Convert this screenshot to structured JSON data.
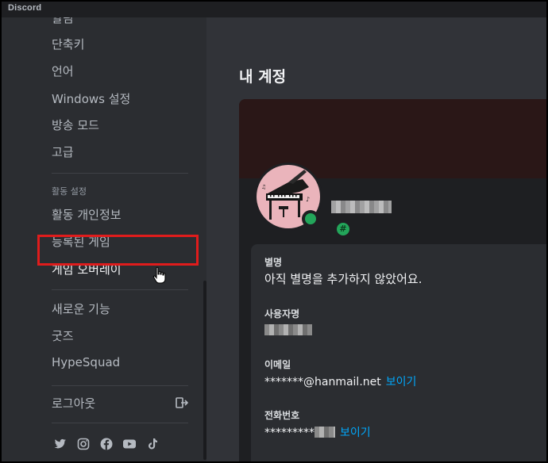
{
  "app": {
    "title": "Discord"
  },
  "sidebar": {
    "cut_item": "알림",
    "app_settings": [
      "단축키",
      "언어",
      "Windows 설정",
      "방송 모드",
      "고급"
    ],
    "activity_header": "활동 설정",
    "activity_items": [
      "활동 개인정보",
      "등록된 게임",
      "게임 오버레이"
    ],
    "misc_items": [
      "새로운 기능",
      "굿즈",
      "HypeSquad"
    ],
    "logout_label": "로그아웃",
    "social_icons": [
      "twitter-icon",
      "instagram-icon",
      "facebook-icon",
      "youtube-icon",
      "tiktok-icon"
    ]
  },
  "main": {
    "title": "내 계정",
    "fields": {
      "display_name": {
        "label": "별명",
        "value": "아직 별명을 추가하지 않았어요."
      },
      "username": {
        "label": "사용자명"
      },
      "email": {
        "label": "이메일",
        "value": "*******@hanmail.net",
        "reveal": "보이기"
      },
      "phone": {
        "label": "전화번호",
        "value": "*********",
        "reveal": "보이기"
      }
    }
  },
  "colors": {
    "accent_link": "#00a8fc",
    "online": "#23a55a",
    "highlight": "#e01c1c"
  }
}
